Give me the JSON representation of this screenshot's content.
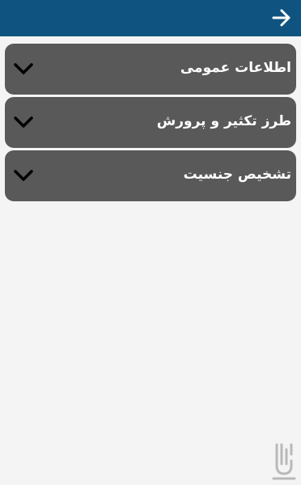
{
  "header": {
    "back_icon": "arrow-right-icon",
    "background_color": "#0f5480"
  },
  "sections": [
    {
      "label": "اطلاعات عمومی",
      "icon": "chevron-down-icon"
    },
    {
      "label": "طرز تکثیر و پرورش",
      "icon": "chevron-down-icon"
    },
    {
      "label": "تشخیص جنسیت",
      "icon": "chevron-down-icon"
    }
  ],
  "colors": {
    "page_background": "#f4f4f4",
    "card_background": "#595959",
    "card_text": "#ffffff",
    "chevron": "#000000"
  },
  "watermark": {
    "icon": "bazaar-logo-icon"
  }
}
